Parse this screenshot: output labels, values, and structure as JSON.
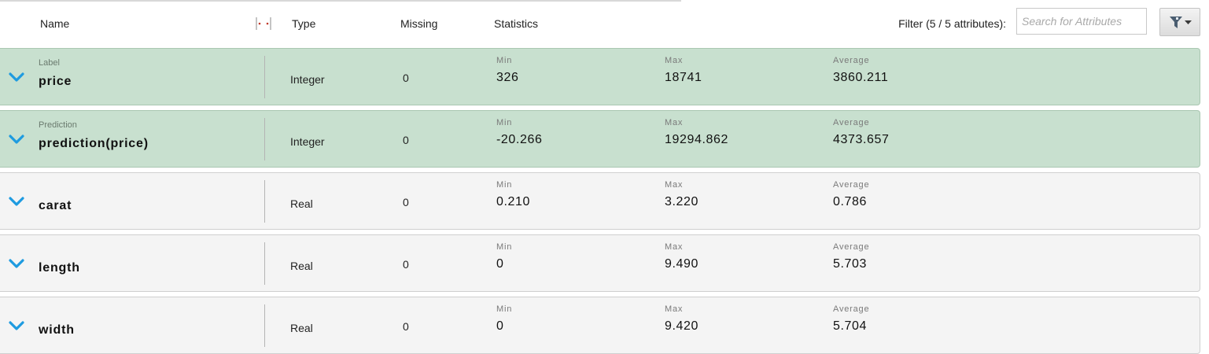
{
  "header": {
    "name": "Name",
    "type": "Type",
    "missing": "Missing",
    "statistics": "Statistics",
    "filter_label": "Filter (5 / 5 attributes):",
    "search_placeholder": "Search for Attributes",
    "filter_icon": "funnel-dropdown-icon"
  },
  "colors": {
    "special_row": "#c8e0cf",
    "regular_row": "#f4f4f4",
    "chevron": "#1e9be0"
  },
  "stat_labels": {
    "min": "Min",
    "max": "Max",
    "avg": "Average"
  },
  "rows": [
    {
      "role": "Label",
      "name": "price",
      "type": "Integer",
      "missing": "0",
      "min": "326",
      "max": "18741",
      "avg": "3860.211",
      "special": true
    },
    {
      "role": "Prediction",
      "name": "prediction(price)",
      "type": "Integer",
      "missing": "0",
      "min": "-20.266",
      "max": "19294.862",
      "avg": "4373.657",
      "special": true
    },
    {
      "role": "",
      "name": "carat",
      "type": "Real",
      "missing": "0",
      "min": "0.210",
      "max": "3.220",
      "avg": "0.786",
      "special": false
    },
    {
      "role": "",
      "name": "length",
      "type": "Real",
      "missing": "0",
      "min": "0",
      "max": "9.490",
      "avg": "5.703",
      "special": false
    },
    {
      "role": "",
      "name": "width",
      "type": "Real",
      "missing": "0",
      "min": "0",
      "max": "9.420",
      "avg": "5.704",
      "special": false
    }
  ]
}
